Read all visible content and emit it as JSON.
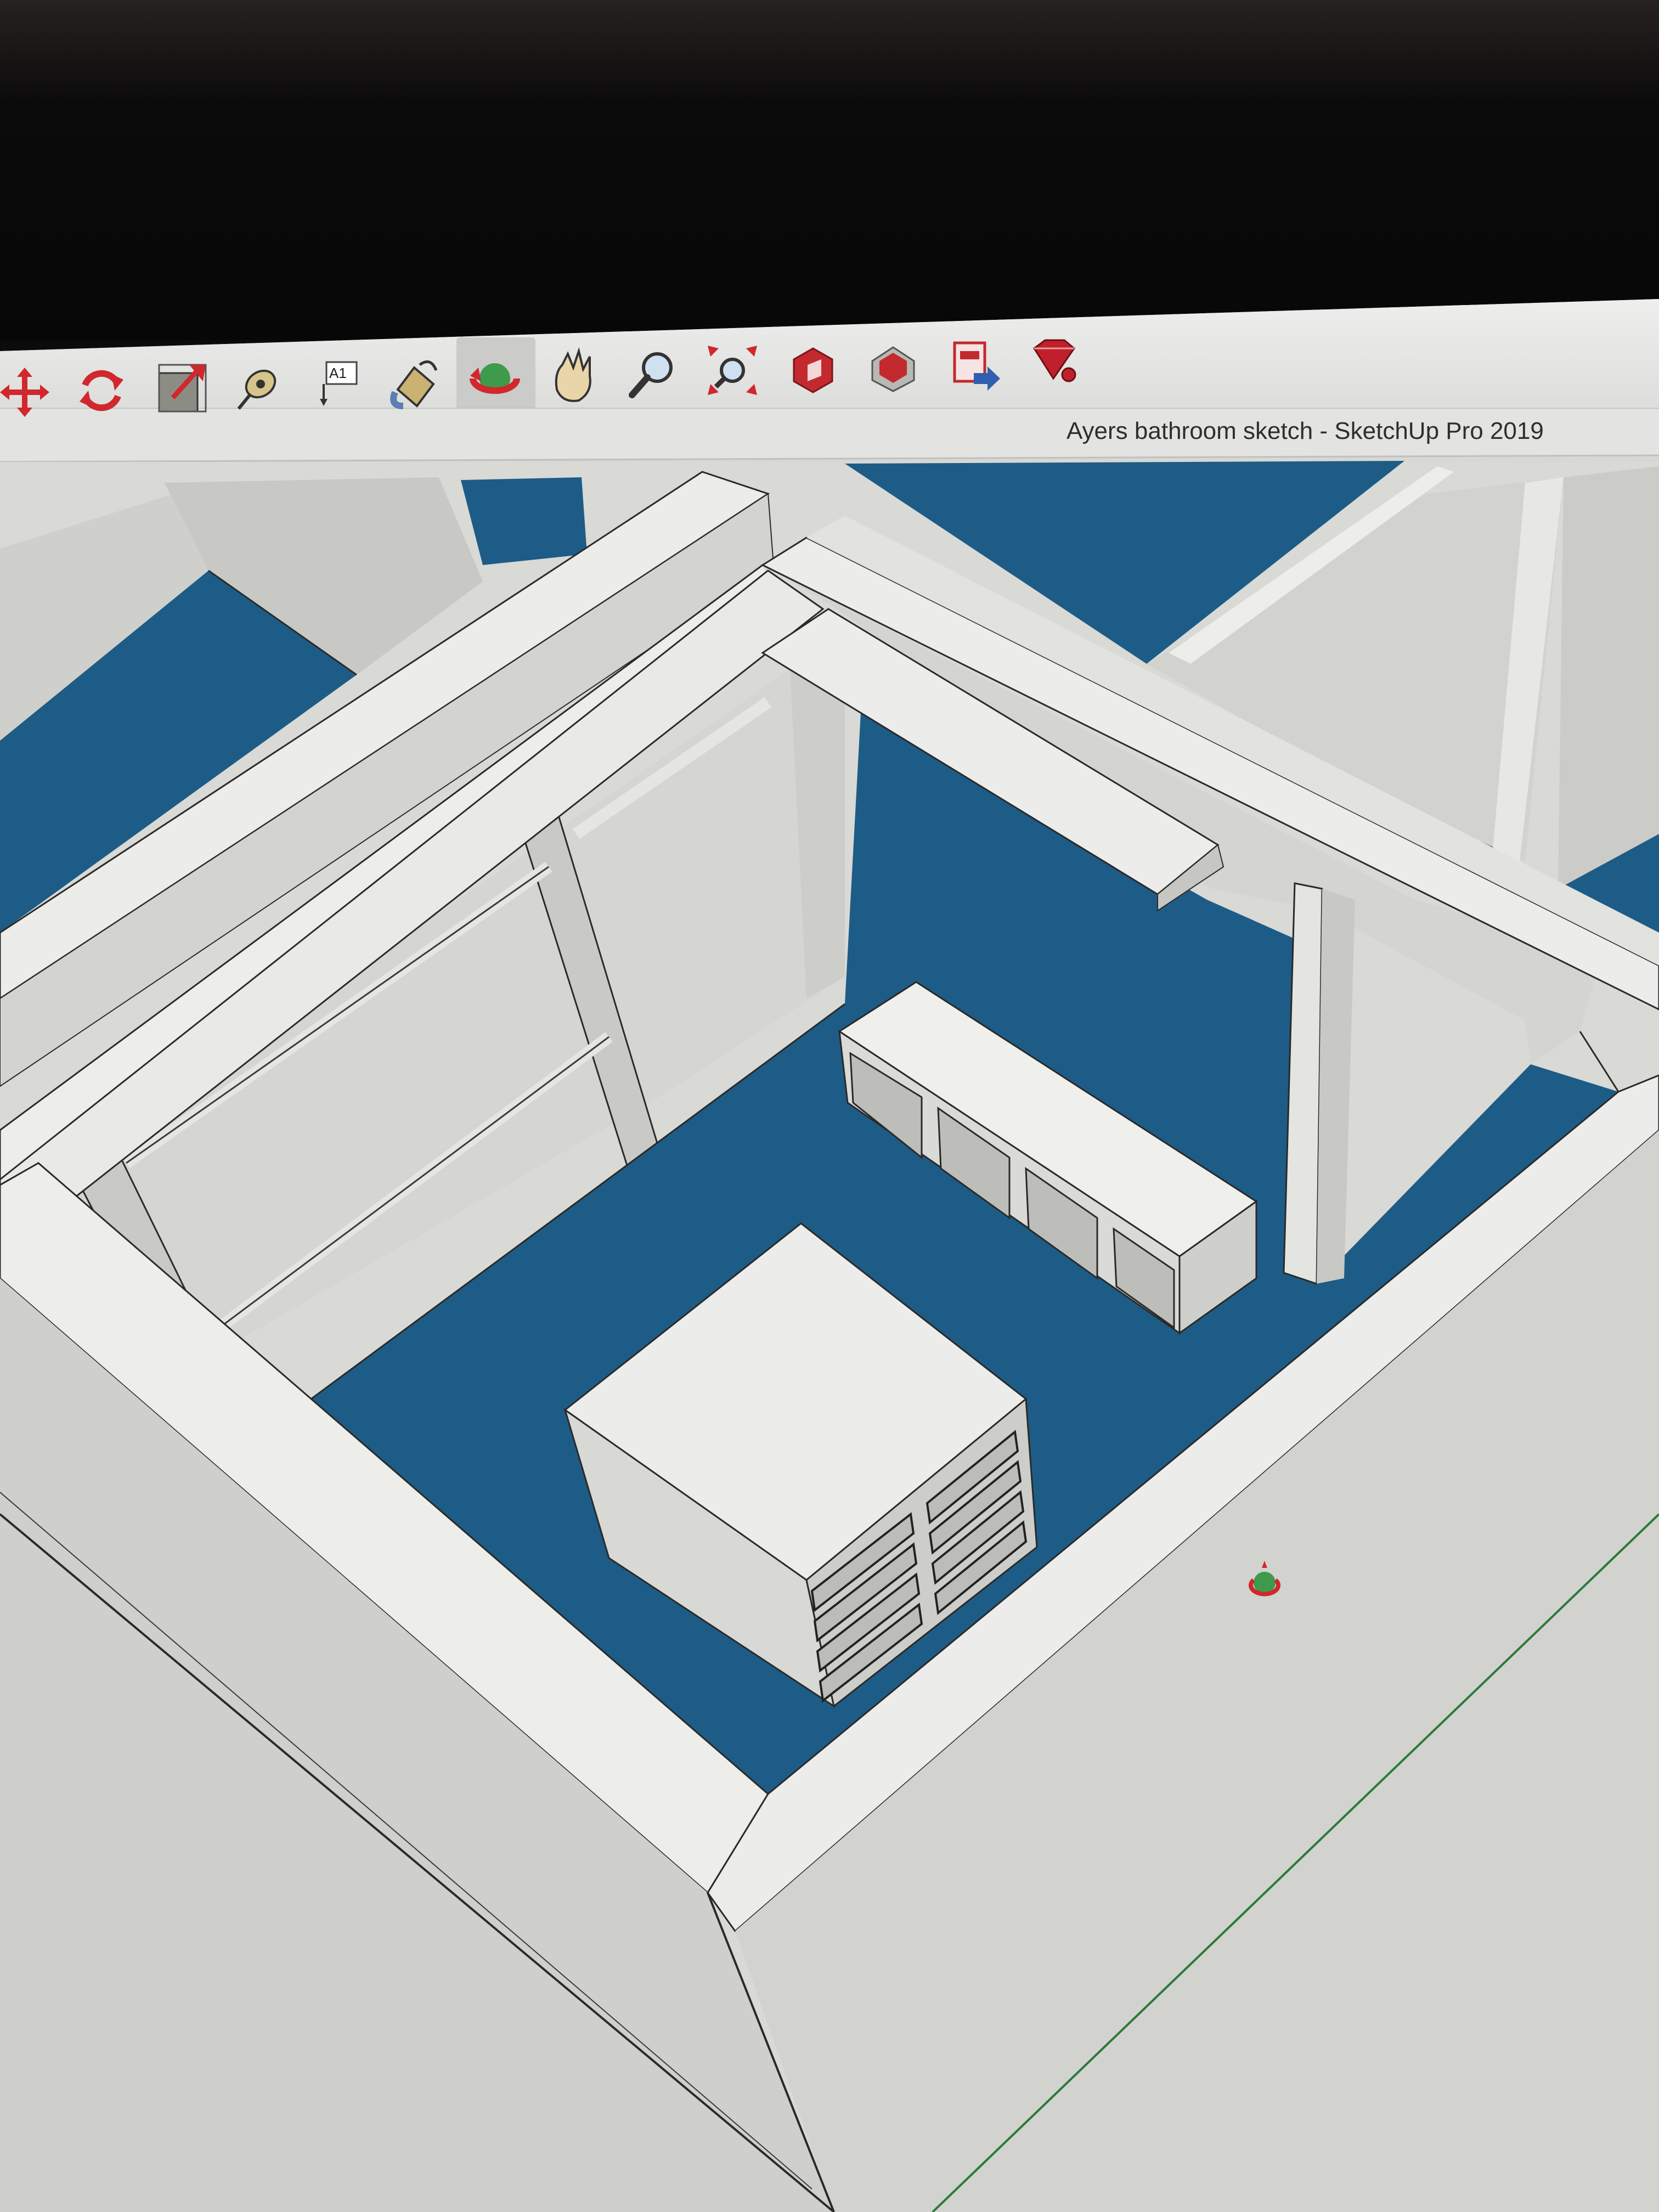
{
  "window": {
    "title": "Ayers bathroom sketch  - SketchUp Pro 2019"
  },
  "toolbar": {
    "tools": [
      {
        "name": "move-tool",
        "icon": "move-icon"
      },
      {
        "name": "rotate-tool",
        "icon": "rotate-icon"
      },
      {
        "name": "scale-tool",
        "icon": "scale-icon"
      },
      {
        "name": "tape-measure-tool",
        "icon": "tape-measure-icon"
      },
      {
        "name": "text-tool",
        "icon": "text-icon",
        "label": "A1"
      },
      {
        "name": "paint-bucket-tool",
        "icon": "paint-bucket-icon"
      },
      {
        "name": "orbit-tool",
        "icon": "orbit-icon",
        "active": true
      },
      {
        "name": "pan-tool",
        "icon": "hand-icon"
      },
      {
        "name": "zoom-tool",
        "icon": "magnifier-icon"
      },
      {
        "name": "zoom-extents-tool",
        "icon": "zoom-extents-icon"
      },
      {
        "name": "3d-warehouse-tool",
        "icon": "warehouse-icon"
      },
      {
        "name": "extension-warehouse-tool",
        "icon": "extension-warehouse-icon"
      },
      {
        "name": "send-to-layout-tool",
        "icon": "layout-icon"
      },
      {
        "name": "ruby-console-tool",
        "icon": "ruby-icon"
      }
    ]
  },
  "colors": {
    "floor_blue": "#1d5c86",
    "wall_face": "#d4d4d0",
    "wall_top": "#ecece9",
    "toolbar_bg": "#e6e6e4",
    "accent_red": "#d0282d"
  }
}
